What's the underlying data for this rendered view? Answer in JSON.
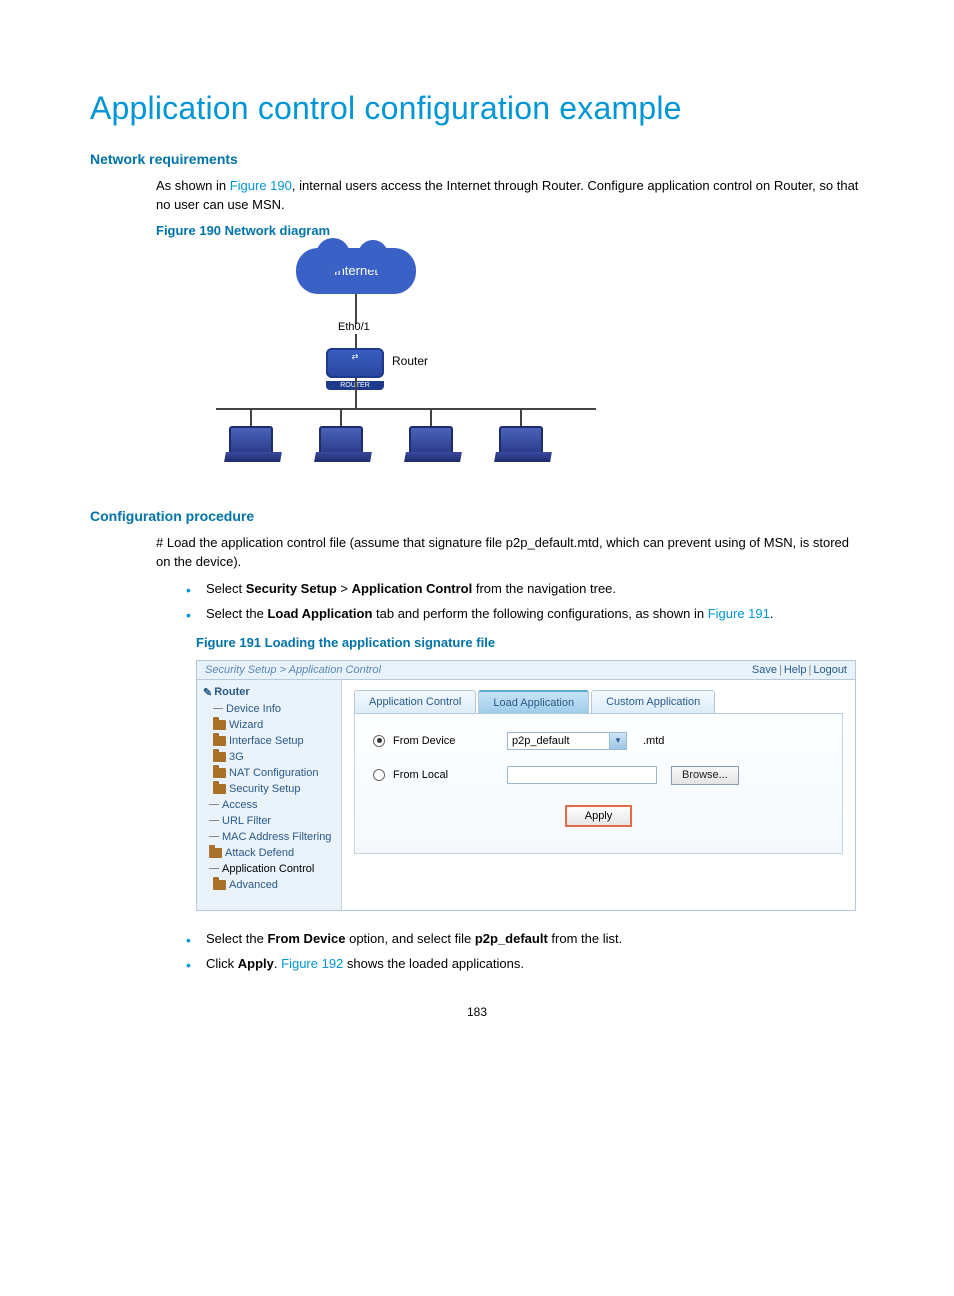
{
  "page_number": "183",
  "title": "Application control configuration example",
  "section_network": {
    "heading": "Network requirements",
    "para_pre": "As shown in ",
    "para_link": "Figure 190",
    "para_post": ", internal users access the Internet through Router. Configure application control on Router, so that no user can use MSN.",
    "fig_caption": "Figure 190 Network diagram",
    "diagram": {
      "cloud": "Internet",
      "interface": "Eth0/1",
      "router": "Router"
    }
  },
  "section_config": {
    "heading": "Configuration procedure",
    "para1": "# Load the application control file (assume that signature file p2p_default.mtd, which can prevent using of MSN, is stored on the device).",
    "bullet1_pre": "Select ",
    "bullet1_b1": "Security Setup",
    "bullet1_mid": " > ",
    "bullet1_b2": "Application Control",
    "bullet1_post": " from the navigation tree.",
    "bullet2_pre": "Select the ",
    "bullet2_b1": "Load Application",
    "bullet2_mid": " tab and perform the following configurations, as shown in ",
    "bullet2_link": "Figure 191",
    "bullet2_post": ".",
    "fig191_caption": "Figure 191 Loading the application signature file",
    "bullet3_pre": "Select the ",
    "bullet3_b1": "From Device",
    "bullet3_mid": " option, and select file ",
    "bullet3_b2": "p2p_default",
    "bullet3_post": " from the list.",
    "bullet4_pre": "Click ",
    "bullet4_b1": "Apply",
    "bullet4_mid": ". ",
    "bullet4_link": "Figure 192",
    "bullet4_post": " shows the loaded applications."
  },
  "screenshot": {
    "breadcrumb": "Security Setup > Application Control",
    "toplinks": {
      "save": "Save",
      "help": "Help",
      "logout": "Logout"
    },
    "nav": {
      "root": "Router",
      "items": [
        "Device Info",
        "Wizard",
        "Interface Setup",
        "3G",
        "NAT Configuration",
        "Security Setup"
      ],
      "security_children": [
        "Access",
        "URL Filter",
        "MAC Address Filtering",
        "Attack Defend",
        "Application Control"
      ],
      "last": "Advanced"
    },
    "tabs": {
      "t1": "Application Control",
      "t2": "Load Application",
      "t3": "Custom Application"
    },
    "form": {
      "from_device": "From Device",
      "from_local": "From Local",
      "select_value": "p2p_default",
      "ext": ".mtd",
      "browse": "Browse...",
      "apply": "Apply"
    }
  }
}
